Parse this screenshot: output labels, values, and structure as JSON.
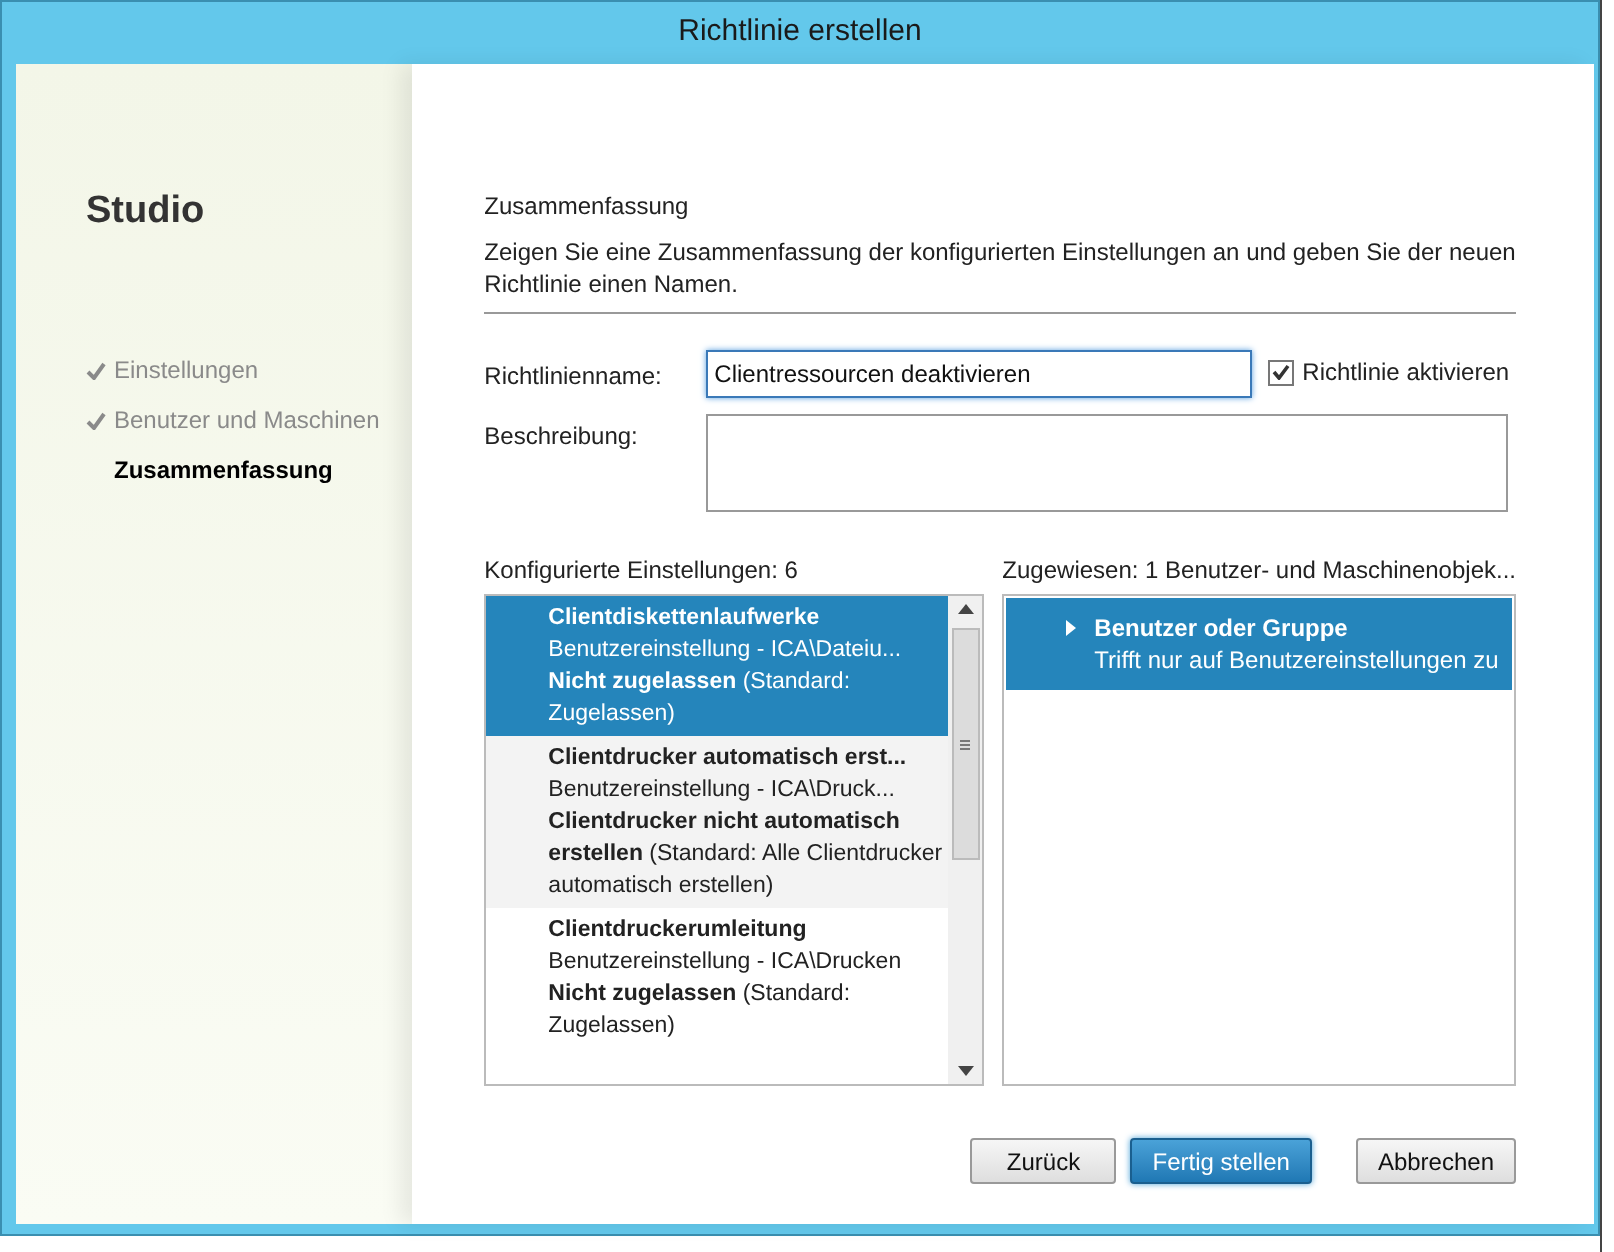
{
  "window": {
    "title": "Richtlinie erstellen"
  },
  "sidebar": {
    "app_title": "Studio",
    "steps": [
      {
        "label": "Einstellungen",
        "done": true,
        "selected": false
      },
      {
        "label": "Benutzer und Maschinen",
        "done": true,
        "selected": false
      },
      {
        "label": "Zusammenfassung",
        "done": false,
        "selected": true
      }
    ]
  },
  "page": {
    "heading": "Zusammenfassung",
    "description": "Zeigen Sie eine Zusammenfassung der konfigurierten Einstellungen an und geben Sie der neuen Richtlinie einen Namen."
  },
  "form": {
    "name_label": "Richtlinienname:",
    "name_value": "Clientressourcen deaktivieren",
    "enable_label": "Richtlinie aktivieren",
    "enable_checked": true,
    "description_label": "Beschreibung:"
  },
  "settings": {
    "label": "Konfigurierte Einstellungen: 6",
    "items": [
      {
        "title": "Clientdiskettenlaufwerke",
        "path": "Benutzereinstellung - ICA\\Dateiu...",
        "detail": "**Nicht zugelassen** (Standard: Zugelassen)",
        "selected": true
      },
      {
        "title": "Clientdrucker automatisch erst...",
        "path": "Benutzereinstellung - ICA\\Druck...",
        "detail": "**Clientdrucker nicht automatisch erstellen** (Standard: Alle Clientdrucker automatisch erstellen)",
        "selected": false
      },
      {
        "title": "Clientdruckerumleitung",
        "path": "Benutzereinstellung - ICA\\Drucken",
        "detail": "**Nicht zugelassen** (Standard: Zugelassen)",
        "selected": false
      }
    ]
  },
  "assigned": {
    "label": "Zugewiesen: 1 Benutzer- und Maschinenobjek...",
    "items": [
      {
        "title": "Benutzer oder Gruppe",
        "detail": "Trifft nur auf Benutzereinstellungen zu",
        "selected": true
      }
    ]
  },
  "buttons": [
    {
      "label": "Zurück",
      "primary": false
    },
    {
      "label": "Fertig stellen",
      "primary": true
    },
    {
      "label": "Abbrechen",
      "primary": false
    }
  ]
}
